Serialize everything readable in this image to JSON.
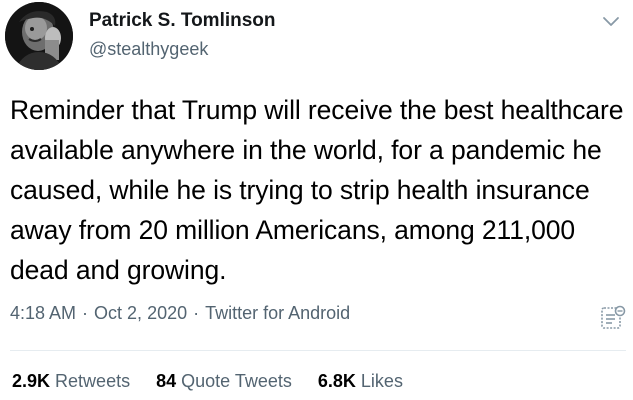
{
  "author": {
    "display_name": "Patrick S. Tomlinson",
    "handle": "@stealthygeek",
    "avatar_icon": "avatar-photo"
  },
  "tweet": {
    "text": "Reminder that Trump will receive the best healthcare available anywhere in the world, for a pandemic he caused, while he is trying to strip health insurance away from 20 million Americans, among 211,000 dead and growing."
  },
  "meta": {
    "time": "4:18 AM",
    "separator": "·",
    "date": "Oct 2, 2020",
    "source": "Twitter for Android"
  },
  "stats": {
    "retweets_count": "2.9K",
    "retweets_label": "Retweets",
    "quotes_count": "84",
    "quotes_label": "Quote Tweets",
    "likes_count": "6.8K",
    "likes_label": "Likes"
  },
  "colors": {
    "text_primary": "#000000",
    "text_secondary": "#536471",
    "divider": "#e6ecf0"
  }
}
